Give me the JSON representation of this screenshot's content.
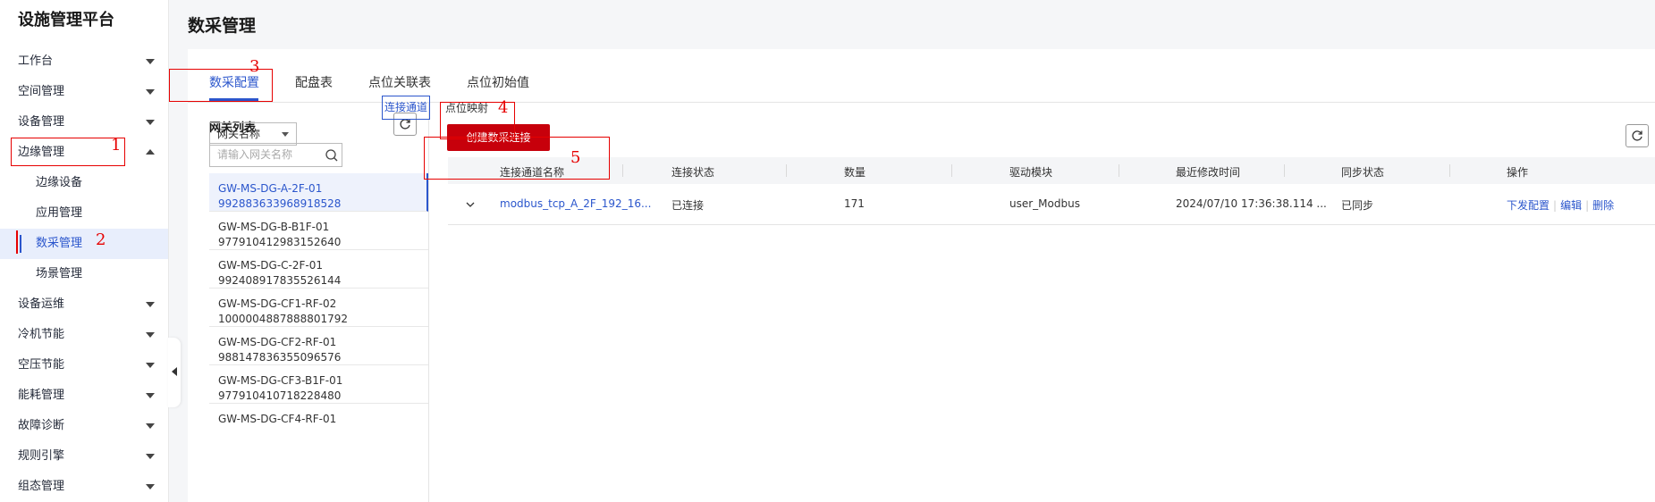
{
  "app": {
    "title": "设施管理平台"
  },
  "sidebar": {
    "items": [
      {
        "label": "工作台",
        "expanded": false
      },
      {
        "label": "空间管理",
        "expanded": false
      },
      {
        "label": "设备管理",
        "expanded": false
      },
      {
        "label": "边缘管理",
        "expanded": true
      },
      {
        "label": "边缘设备"
      },
      {
        "label": "应用管理"
      },
      {
        "label": "数采管理",
        "active": true
      },
      {
        "label": "场景管理"
      },
      {
        "label": "设备运维",
        "expanded": false
      },
      {
        "label": "冷机节能",
        "expanded": false
      },
      {
        "label": "空压节能",
        "expanded": false
      },
      {
        "label": "能耗管理",
        "expanded": false
      },
      {
        "label": "故障诊断",
        "expanded": false
      },
      {
        "label": "规则引擎",
        "expanded": false
      },
      {
        "label": "组态管理",
        "expanded": false
      }
    ]
  },
  "page": {
    "title": "数采管理"
  },
  "tabs": [
    {
      "label": "数采配置",
      "active": true
    },
    {
      "label": "配盘表"
    },
    {
      "label": "点位关联表"
    },
    {
      "label": "点位初始值"
    }
  ],
  "gateway_panel": {
    "title": "网关列表",
    "filter_select": "网关名称",
    "search_placeholder": "请输入网关名称",
    "items": [
      {
        "name": "GW-MS-DG-A-2F-01",
        "id": "992883633968918528",
        "active": true
      },
      {
        "name": "GW-MS-DG-B-B1F-01",
        "id": "977910412983152640"
      },
      {
        "name": "GW-MS-DG-C-2F-01",
        "id": "992408917835526144"
      },
      {
        "name": "GW-MS-DG-CF1-RF-02",
        "id": "1000004887888801792"
      },
      {
        "name": "GW-MS-DG-CF2-RF-01",
        "id": "988147836355096576"
      },
      {
        "name": "GW-MS-DG-CF3-B1F-01",
        "id": "977910410718228480"
      },
      {
        "name": "GW-MS-DG-CF4-RF-01",
        "id": ""
      }
    ]
  },
  "subtabs": [
    {
      "label": "连接通道",
      "active": true
    },
    {
      "label": "点位映射"
    }
  ],
  "create_button": "创建数采连接",
  "table": {
    "headers": [
      "连接通道名称",
      "连接状态",
      "数量",
      "驱动模块",
      "最近修改时间",
      "同步状态",
      "操作"
    ],
    "rows": [
      {
        "name": "modbus_tcp_A_2F_192_16...",
        "status": "已连接",
        "count": "171",
        "driver": "user_Modbus",
        "modified": "2024/07/10 17:36:38.114 ...",
        "sync": "已同步",
        "ops": [
          "下发配置",
          "编辑",
          "删除"
        ]
      }
    ]
  },
  "annotations": [
    "1",
    "2",
    "3",
    "4",
    "5"
  ],
  "colors": {
    "accent": "#2b56cc",
    "primary_button": "#c7000b",
    "annotation": "#e60000"
  }
}
